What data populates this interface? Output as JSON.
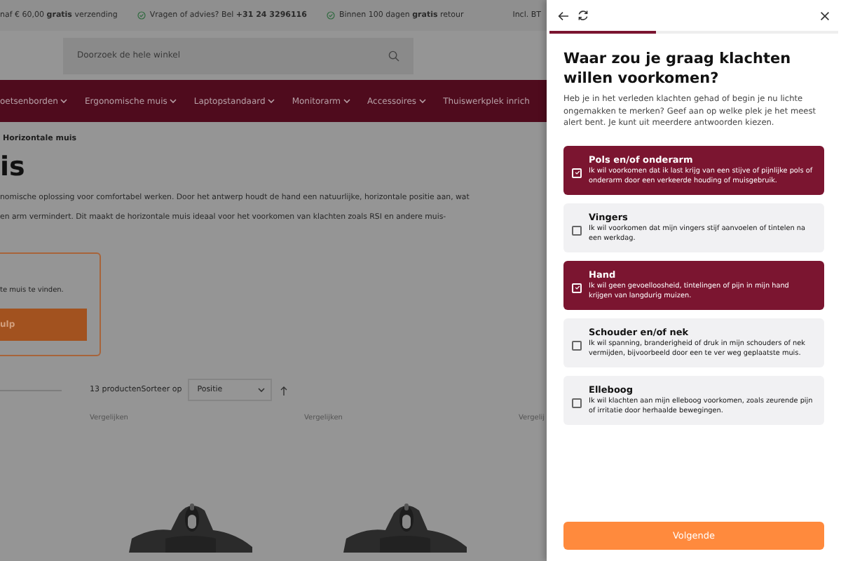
{
  "topbar": {
    "usps": [
      {
        "text": "naf € 60,00 **gratis** verzending",
        "icon": false
      },
      {
        "text": "Vragen of advies? Bel **+31 24 3296116**",
        "icon": true
      },
      {
        "text": "Binnen 100 dagen **gratis** retour",
        "icon": true
      }
    ],
    "right": "Incl. BT"
  },
  "search": {
    "placeholder": "Doorzoek de hele winkel"
  },
  "nav": [
    "oetsenborden",
    "Ergonomische muis",
    "Laptopstandaard",
    "Monitorarm",
    "Accessoires",
    "Thuiswerkplek inrich"
  ],
  "breadcrumb": "Horizontale muis",
  "page_title": "is",
  "intro": [
    "nomische oplossing voor comfortabel werken. Door het antwerp houdt de hand een natuurlijke, horizontale positie aan, wat",
    "en arm vermindert. Dit maakt de horizontale muis ideaal voor het voorkomen van klachten zoals RSI en andere muis-"
  ],
  "help_box": {
    "text": "te muis te vinden.",
    "button": "ulp"
  },
  "toolbar": {
    "count": "13 producten",
    "sort_label": "Sorteer op",
    "sort_value": "Positie"
  },
  "products": [
    {
      "compare": "Vergelijken",
      "kind": "picture"
    },
    {
      "compare": "Vergelijken",
      "kind": "picture"
    },
    {
      "compare": "Vergelij"
    }
  ],
  "panel": {
    "progress": {
      "level": 0.37
    },
    "title": "Waar zou je graag klachten willen voorkomen?",
    "description": "Heb je in het verleden klachten gehad of begin je nu lichte ongemakken te merken? Geef aan op welke plek je het meest alert bent. Je kunt uit meerdere antwoorden kiezen.",
    "options": [
      {
        "title": "Pols en/of onderarm",
        "description": "Ik wil voorkomen dat ik last krijg van een stijve of pijnlijke pols of onderarm door een verkeerde houding of muisgebruik.",
        "checked": true
      },
      {
        "title": "Vingers",
        "description": "Ik wil voorkomen dat mijn vingers stijf aanvoelen of tintelen na een werkdag.",
        "checked": false
      },
      {
        "title": "Hand",
        "description": "Ik wil geen gevoelloosheid, tintelingen of pijn in mijn hand krijgen van langdurig muizen.",
        "checked": true
      },
      {
        "title": "Schouder en/of nek",
        "description": "Ik wil spanning, branderigheid of druk in mijn schouders of nek vermijden, bijvoorbeeld door een te ver weg geplaatste muis.",
        "checked": false
      },
      {
        "title": "Elleboog",
        "description": "Ik wil klachten aan mijn elleboog voorkomen, zoals zeurende pijn of irritatie door herhaalde bewegingen.",
        "checked": false
      }
    ],
    "next_button": "Volgende"
  }
}
